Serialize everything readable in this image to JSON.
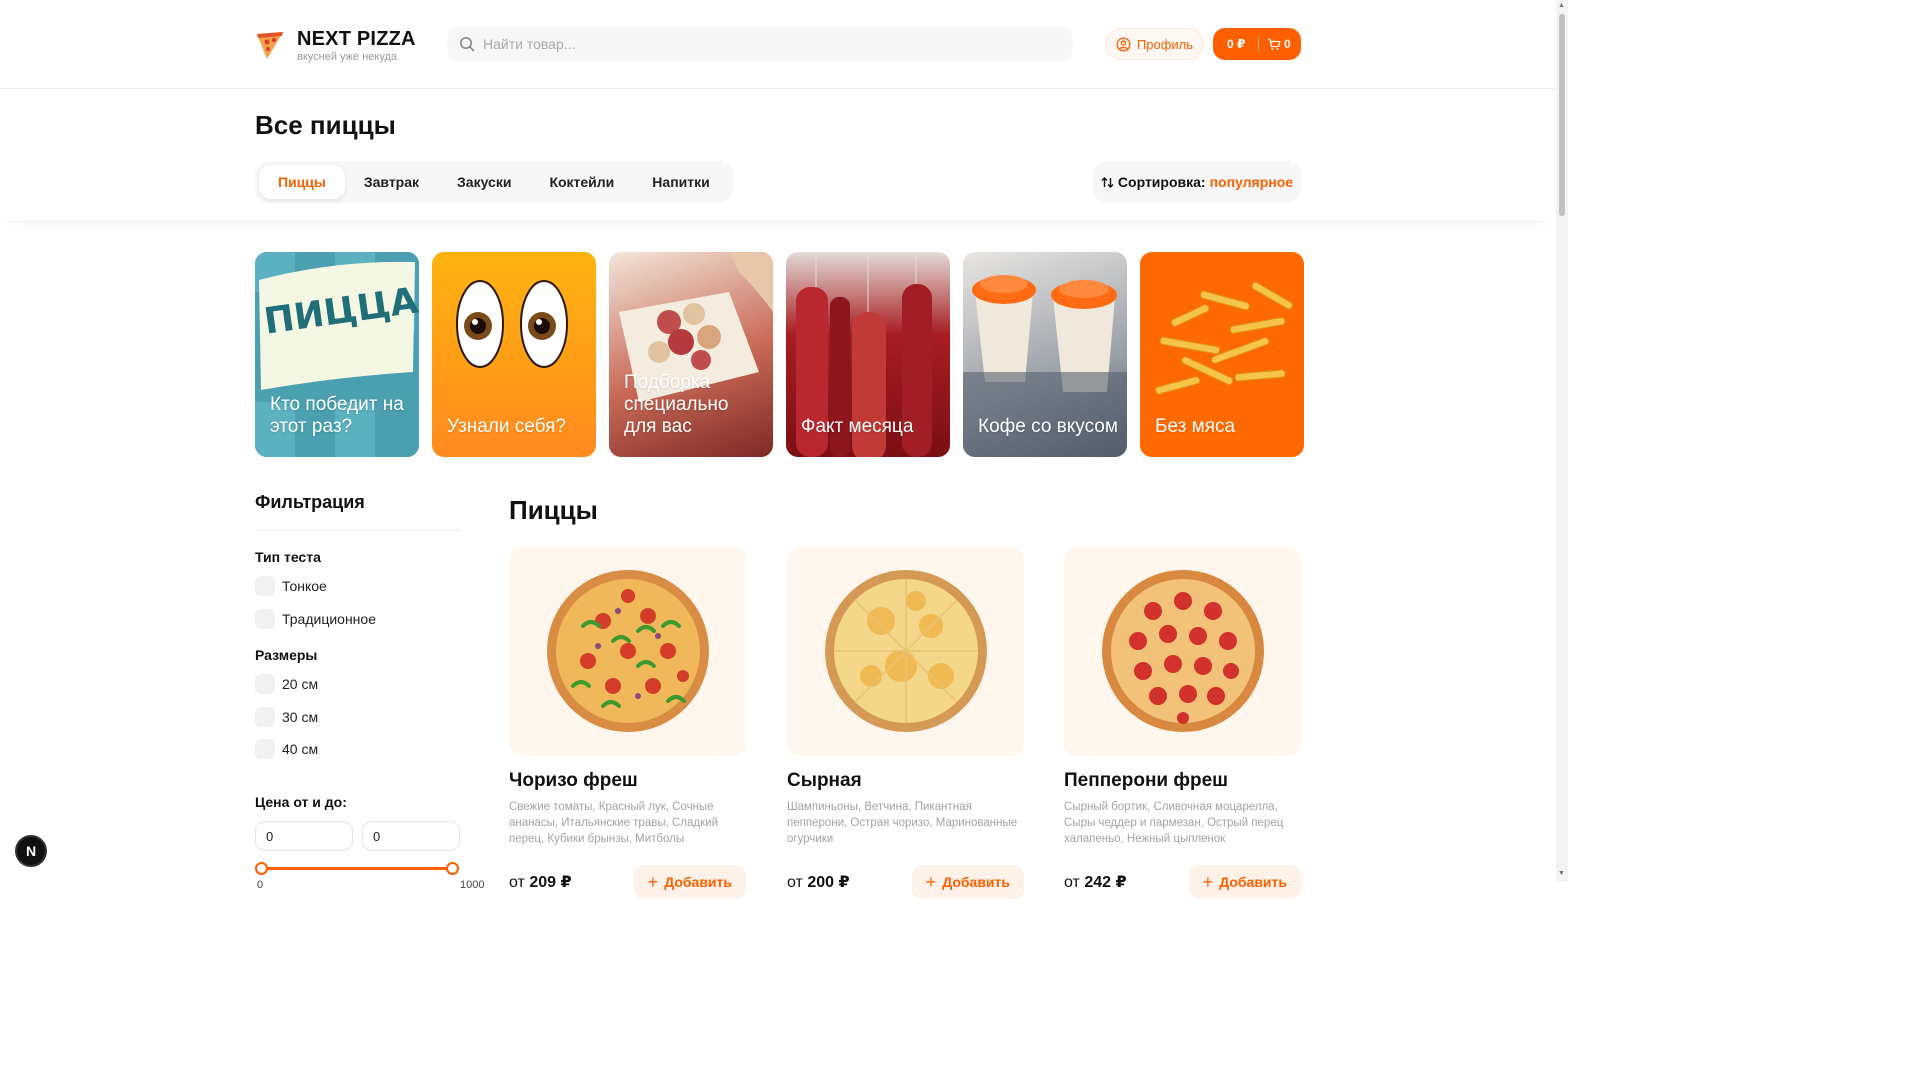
{
  "header": {
    "logo_title": "NEXT PIZZA",
    "logo_subtitle": "вкусней уже некуда",
    "search_placeholder": "Найти товар...",
    "profile_label": "Профиль",
    "cart_sum": "0 ₽",
    "cart_count": "0"
  },
  "page_title": "Все пиццы",
  "categories": [
    "Пиццы",
    "Завтрак",
    "Закуски",
    "Коктейли",
    "Напитки"
  ],
  "active_category": "Пиццы",
  "sort": {
    "label": "Сортировка:",
    "value": "популярное"
  },
  "stories": [
    {
      "text": "Кто победит на этот раз?",
      "art_text": "ПИЦЦА ФЕСТ"
    },
    {
      "text": "Узнали себя?"
    },
    {
      "text": "Подборка специально для вас"
    },
    {
      "text": "Факт месяца"
    },
    {
      "text": "Кофе со вкусом"
    },
    {
      "text": "Без мяса"
    }
  ],
  "filters": {
    "title": "Фильтрация",
    "dough_title": "Тип теста",
    "dough_options": [
      "Тонкое",
      "Традиционное"
    ],
    "sizes_title": "Размеры",
    "size_options": [
      "20 см",
      "30 см",
      "40 см"
    ],
    "price_title": "Цена от и до:",
    "price_from": "0",
    "price_to": "0",
    "slider_min": "0",
    "slider_max": "1000"
  },
  "section_title": "Пиццы",
  "products": [
    {
      "name": "Чоризо фреш",
      "description": "Свежие томаты, Красный лук, Сочные ананасы, Итальянские травы, Сладкий перец, Кубики брынзы, Митболы",
      "price_prefix": "от",
      "price": "209 ₽",
      "add_label": "Добавить"
    },
    {
      "name": "Сырная",
      "description": "Шампиньоны, Ветчина, Пикантная пепперони, Острая чоризо, Маринованные огурчики",
      "price_prefix": "от",
      "price": "200 ₽",
      "add_label": "Добавить"
    },
    {
      "name": "Пепперони фреш",
      "description": "Сырный бортик, Сливочная моцарелла, Сыры чеддер и пармезан, Острый перец халапеньо, Нежный цыпленок",
      "price_prefix": "от",
      "price": "242 ₽",
      "add_label": "Добавить"
    }
  ],
  "next_badge": "N",
  "colors": {
    "accent": "#fe5f00",
    "accent_light": "#fff2e9",
    "muted_text": "#a3a3a3"
  }
}
